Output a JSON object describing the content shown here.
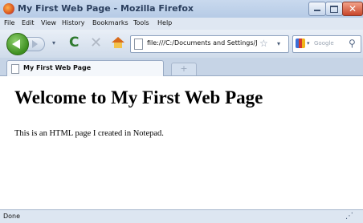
{
  "window": {
    "title": "My First Web Page - Mozilla Firefox",
    "minimize_glyph": "",
    "close_glyph": "✕"
  },
  "menu": [
    "File",
    "Edit",
    "View",
    "History",
    "Bookmarks",
    "Tools",
    "Help"
  ],
  "nav": {
    "reload_glyph": "C",
    "stop_glyph": "✕",
    "dropdown_glyph": "▾",
    "url": "file:///C:/Documents and Settings/J",
    "star_glyph": "☆",
    "search_placeholder": "Google",
    "search_glyph": "⚲"
  },
  "tabs": {
    "active_label": "My First Web Page",
    "new_tab_glyph": "+"
  },
  "content": {
    "heading": "Welcome to My First Web Page",
    "paragraph": "This is an HTML page I created in Notepad."
  },
  "status": {
    "text": "Done",
    "grip_glyph": "⋰"
  },
  "colors": {
    "chrome": "#d7e4f2",
    "back_button": "#3d8f1f",
    "close_button": "#c8462a"
  }
}
